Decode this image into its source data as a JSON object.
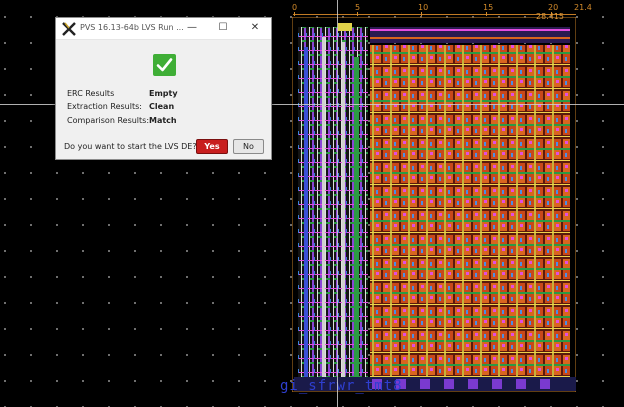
{
  "canvas": {
    "ruler_labels": [
      "0",
      "5",
      "10",
      "15",
      "20",
      "21.4"
    ],
    "coordinate_readout": "28.415",
    "bottom_label": "gi_sfrwr_tmt8"
  },
  "dialog": {
    "title": "PVS 16.13-64b LVS  Run ...",
    "minimize_label": "—",
    "maximize_label": "☐",
    "close_label": "✕",
    "rows": [
      {
        "label": "ERC Results",
        "value": "Empty"
      },
      {
        "label": "Extraction Results:",
        "value": "Clean"
      },
      {
        "label": "Comparison Results:",
        "value": "Match"
      }
    ],
    "question": "Do you want to start the LVS DE?",
    "yes_label": "Yes",
    "no_label": "No",
    "status_color": "#3fae36"
  }
}
